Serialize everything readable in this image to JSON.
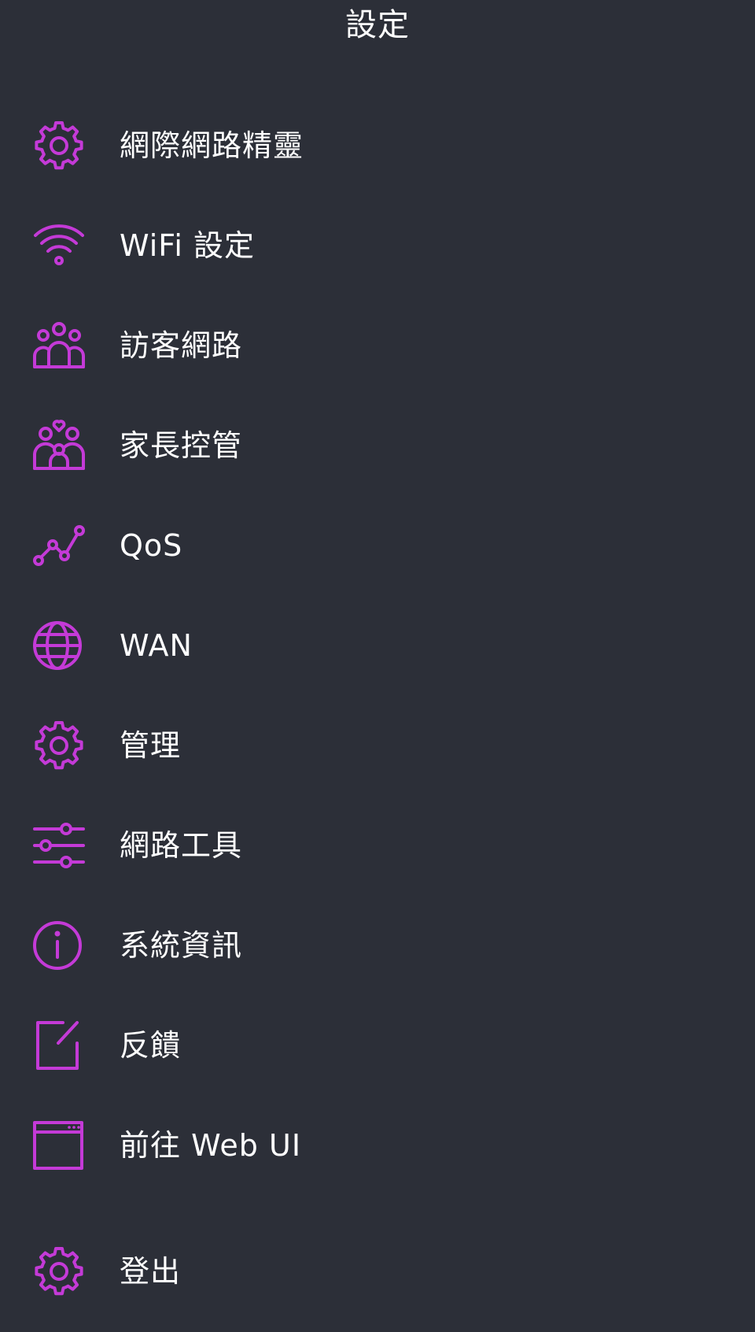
{
  "header": {
    "title": "設定"
  },
  "menu": {
    "items": [
      {
        "id": "internet-wizard",
        "label": "網際網路精靈",
        "icon": "gear-icon"
      },
      {
        "id": "wifi-settings",
        "label": "WiFi 設定",
        "icon": "wifi-icon"
      },
      {
        "id": "guest-network",
        "label": "訪客網路",
        "icon": "group-icon"
      },
      {
        "id": "parental-control",
        "label": "家長控管",
        "icon": "family-icon"
      },
      {
        "id": "qos",
        "label": "QoS",
        "icon": "qos-graph-icon"
      },
      {
        "id": "wan",
        "label": "WAN",
        "icon": "globe-icon"
      },
      {
        "id": "administration",
        "label": "管理",
        "icon": "gear-icon"
      },
      {
        "id": "network-tools",
        "label": "網路工具",
        "icon": "sliders-icon"
      },
      {
        "id": "system-info",
        "label": "系統資訊",
        "icon": "info-icon"
      },
      {
        "id": "feedback",
        "label": "反饋",
        "icon": "edit-icon"
      },
      {
        "id": "web-ui",
        "label": "前往 Web UI",
        "icon": "browser-window-icon"
      },
      {
        "id": "logout",
        "label": "登出",
        "icon": "gear-icon"
      }
    ]
  },
  "colors": {
    "background": "#2c2f38",
    "accent": "#c43ad7",
    "text": "#ffffff"
  }
}
